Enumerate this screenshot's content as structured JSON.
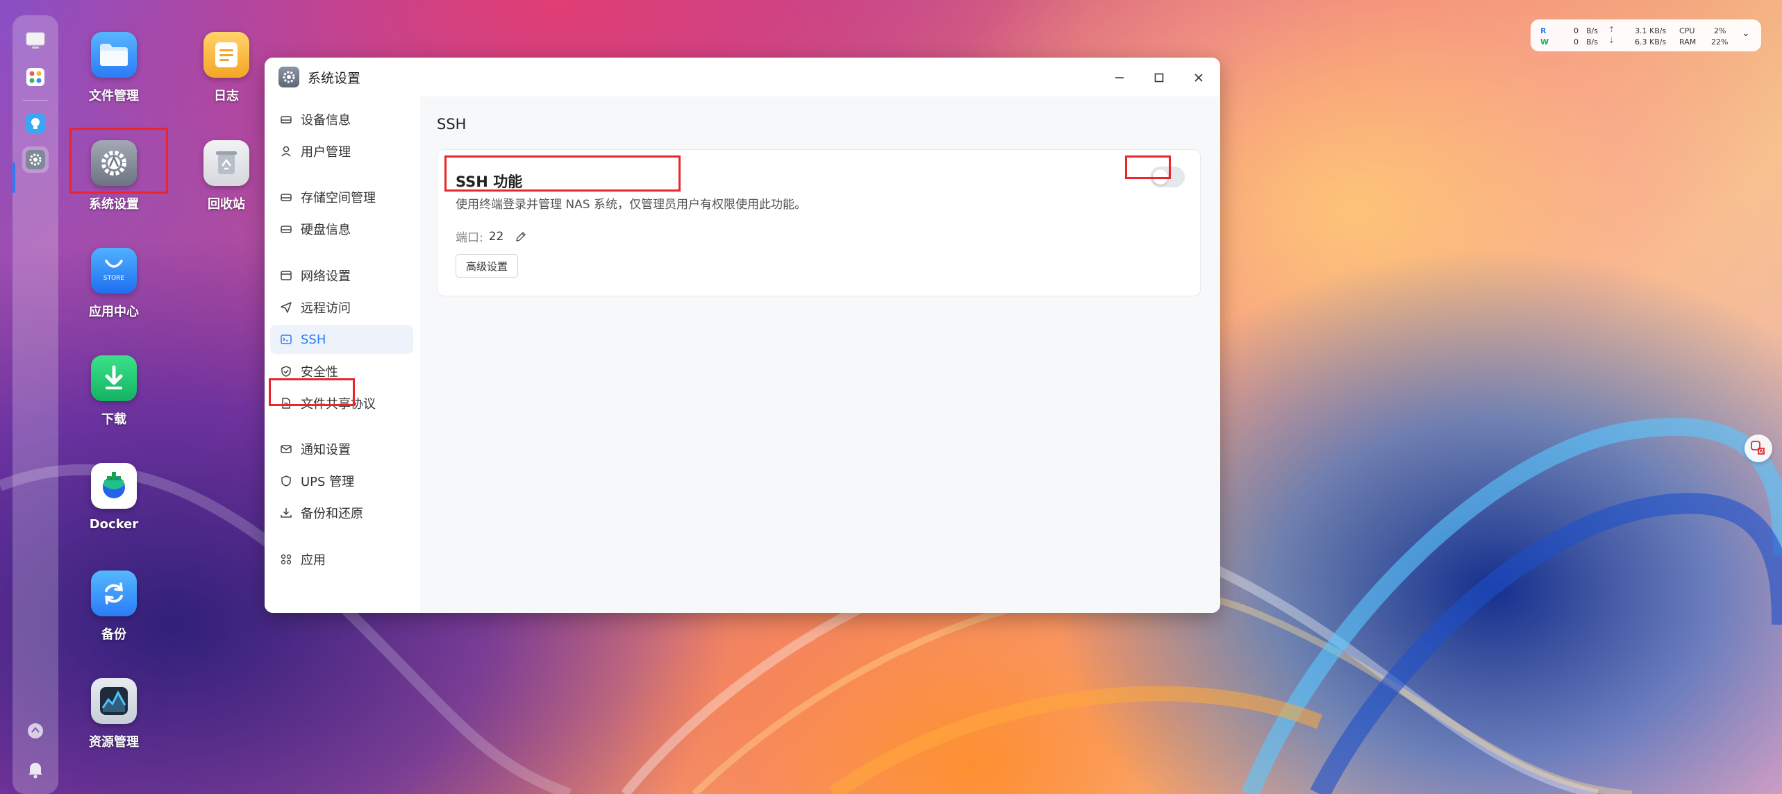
{
  "desktop": {
    "icons": [
      {
        "label": "文件管理"
      },
      {
        "label": "日志"
      },
      {
        "label": "系统设置"
      },
      {
        "label": "回收站"
      },
      {
        "label": "应用中心",
        "store_text": "STORE"
      },
      {
        "label": "下载"
      },
      {
        "label": "Docker"
      },
      {
        "label": "备份"
      },
      {
        "label": "资源管理"
      }
    ]
  },
  "window": {
    "title": "系统设置"
  },
  "sidebar": {
    "items": [
      {
        "label": "设备信息",
        "icon": "device-icon"
      },
      {
        "label": "用户管理",
        "icon": "user-icon"
      },
      {
        "label": "存储空间管理",
        "icon": "storage-icon"
      },
      {
        "label": "硬盘信息",
        "icon": "disk-icon"
      },
      {
        "label": "网络设置",
        "icon": "network-icon"
      },
      {
        "label": "远程访问",
        "icon": "send-icon"
      },
      {
        "label": "SSH",
        "icon": "terminal-icon"
      },
      {
        "label": "安全性",
        "icon": "shield-check-icon"
      },
      {
        "label": "文件共享协议",
        "icon": "file-icon"
      },
      {
        "label": "通知设置",
        "icon": "mail-icon"
      },
      {
        "label": "UPS 管理",
        "icon": "ups-shield-icon"
      },
      {
        "label": "备份和还原",
        "icon": "download-icon"
      },
      {
        "label": "应用",
        "icon": "apps-grid-icon"
      }
    ],
    "active": "SSH"
  },
  "main": {
    "section_title": "SSH",
    "card": {
      "heading": "SSH 功能",
      "description": "使用终端登录并管理 NAS 系统，仅管理员用户有权限使用此功能。",
      "port_label": "端口:",
      "port_value": "22",
      "advanced_button": "高级设置",
      "toggle_on": false
    }
  },
  "perf_widget": {
    "read_label": "R",
    "write_label": "W",
    "read_disk": "0",
    "write_disk": "0",
    "disk_unit": "B/s",
    "up_speed": "3.1 KB/s",
    "down_speed": "6.3 KB/s",
    "cpu_label": "CPU",
    "ram_label": "RAM",
    "cpu_value": "2%",
    "ram_value": "22%"
  },
  "colors": {
    "accent": "#2a7cf7",
    "highlight_box": "#e8262b"
  }
}
